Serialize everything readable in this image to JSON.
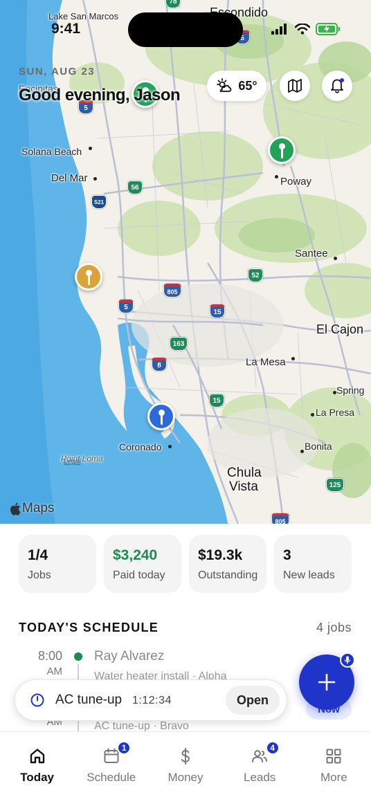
{
  "status_bar": {
    "time": "9:41"
  },
  "header": {
    "date": "SUN, AUG 23",
    "greeting": "Good evening, Jason",
    "weather_temp": "65°",
    "weather_icon": "cloud-sun-icon"
  },
  "map": {
    "attribution": "Maps",
    "legal": "Legal",
    "places": {
      "lake_san_marcos": "Lake San Marcos",
      "escondido": "Escondido",
      "encinitas": "Encinitas",
      "solana_beach": "Solana Beach",
      "del_mar": "Del Mar",
      "poway": "Poway",
      "santee": "Santee",
      "el_cajon": "El Cajon",
      "la_mesa": "La Mesa",
      "spring": "Spring",
      "la_presa": "La Presa",
      "bonita": "Bonita",
      "coronado": "Coronado",
      "point_loma": "Point Loma",
      "chula": "Chula",
      "vista": "Vista"
    },
    "shields": {
      "s5a": "5",
      "s56": "56",
      "s21": "S21",
      "s5b": "5",
      "s805a": "805",
      "s15a": "15",
      "s52": "52",
      "s163": "163",
      "s8": "8",
      "s15b": "15",
      "s125": "125",
      "s805b": "805",
      "s78": "78",
      "s5c": "5"
    },
    "pin_colors": {
      "green": "#21a35a",
      "gold": "#d9a43a",
      "blue": "#2d6ad9"
    }
  },
  "stats": [
    {
      "value": "1/4",
      "label": "Jobs"
    },
    {
      "value": "$3,240",
      "label": "Paid today"
    },
    {
      "value": "$19.3k",
      "label": "Outstanding"
    },
    {
      "value": "3",
      "label": "New leads"
    }
  ],
  "schedule": {
    "title": "TODAY'S SCHEDULE",
    "count": "4 jobs",
    "rows": [
      {
        "time": "8:00",
        "ampm": "AM",
        "name": "Ray Alvarez",
        "detail": "Water heater install · Alpha"
      },
      {
        "ampm": "AM",
        "detail": "AC tune-up · Bravo"
      }
    ]
  },
  "timer": {
    "label": "AC tune-up",
    "elapsed": "1:12:34",
    "open_label": "Open"
  },
  "now_badge": "Now",
  "tabs": [
    {
      "label": "Today",
      "icon": "home-icon"
    },
    {
      "label": "Schedule",
      "icon": "calendar-icon",
      "badge": "1"
    },
    {
      "label": "Money",
      "icon": "dollar-icon"
    },
    {
      "label": "Leads",
      "icon": "users-icon",
      "badge": "4"
    },
    {
      "label": "More",
      "icon": "grid-icon"
    }
  ],
  "colors": {
    "accent": "#1f35c9",
    "money_green": "#1c8c4e"
  }
}
